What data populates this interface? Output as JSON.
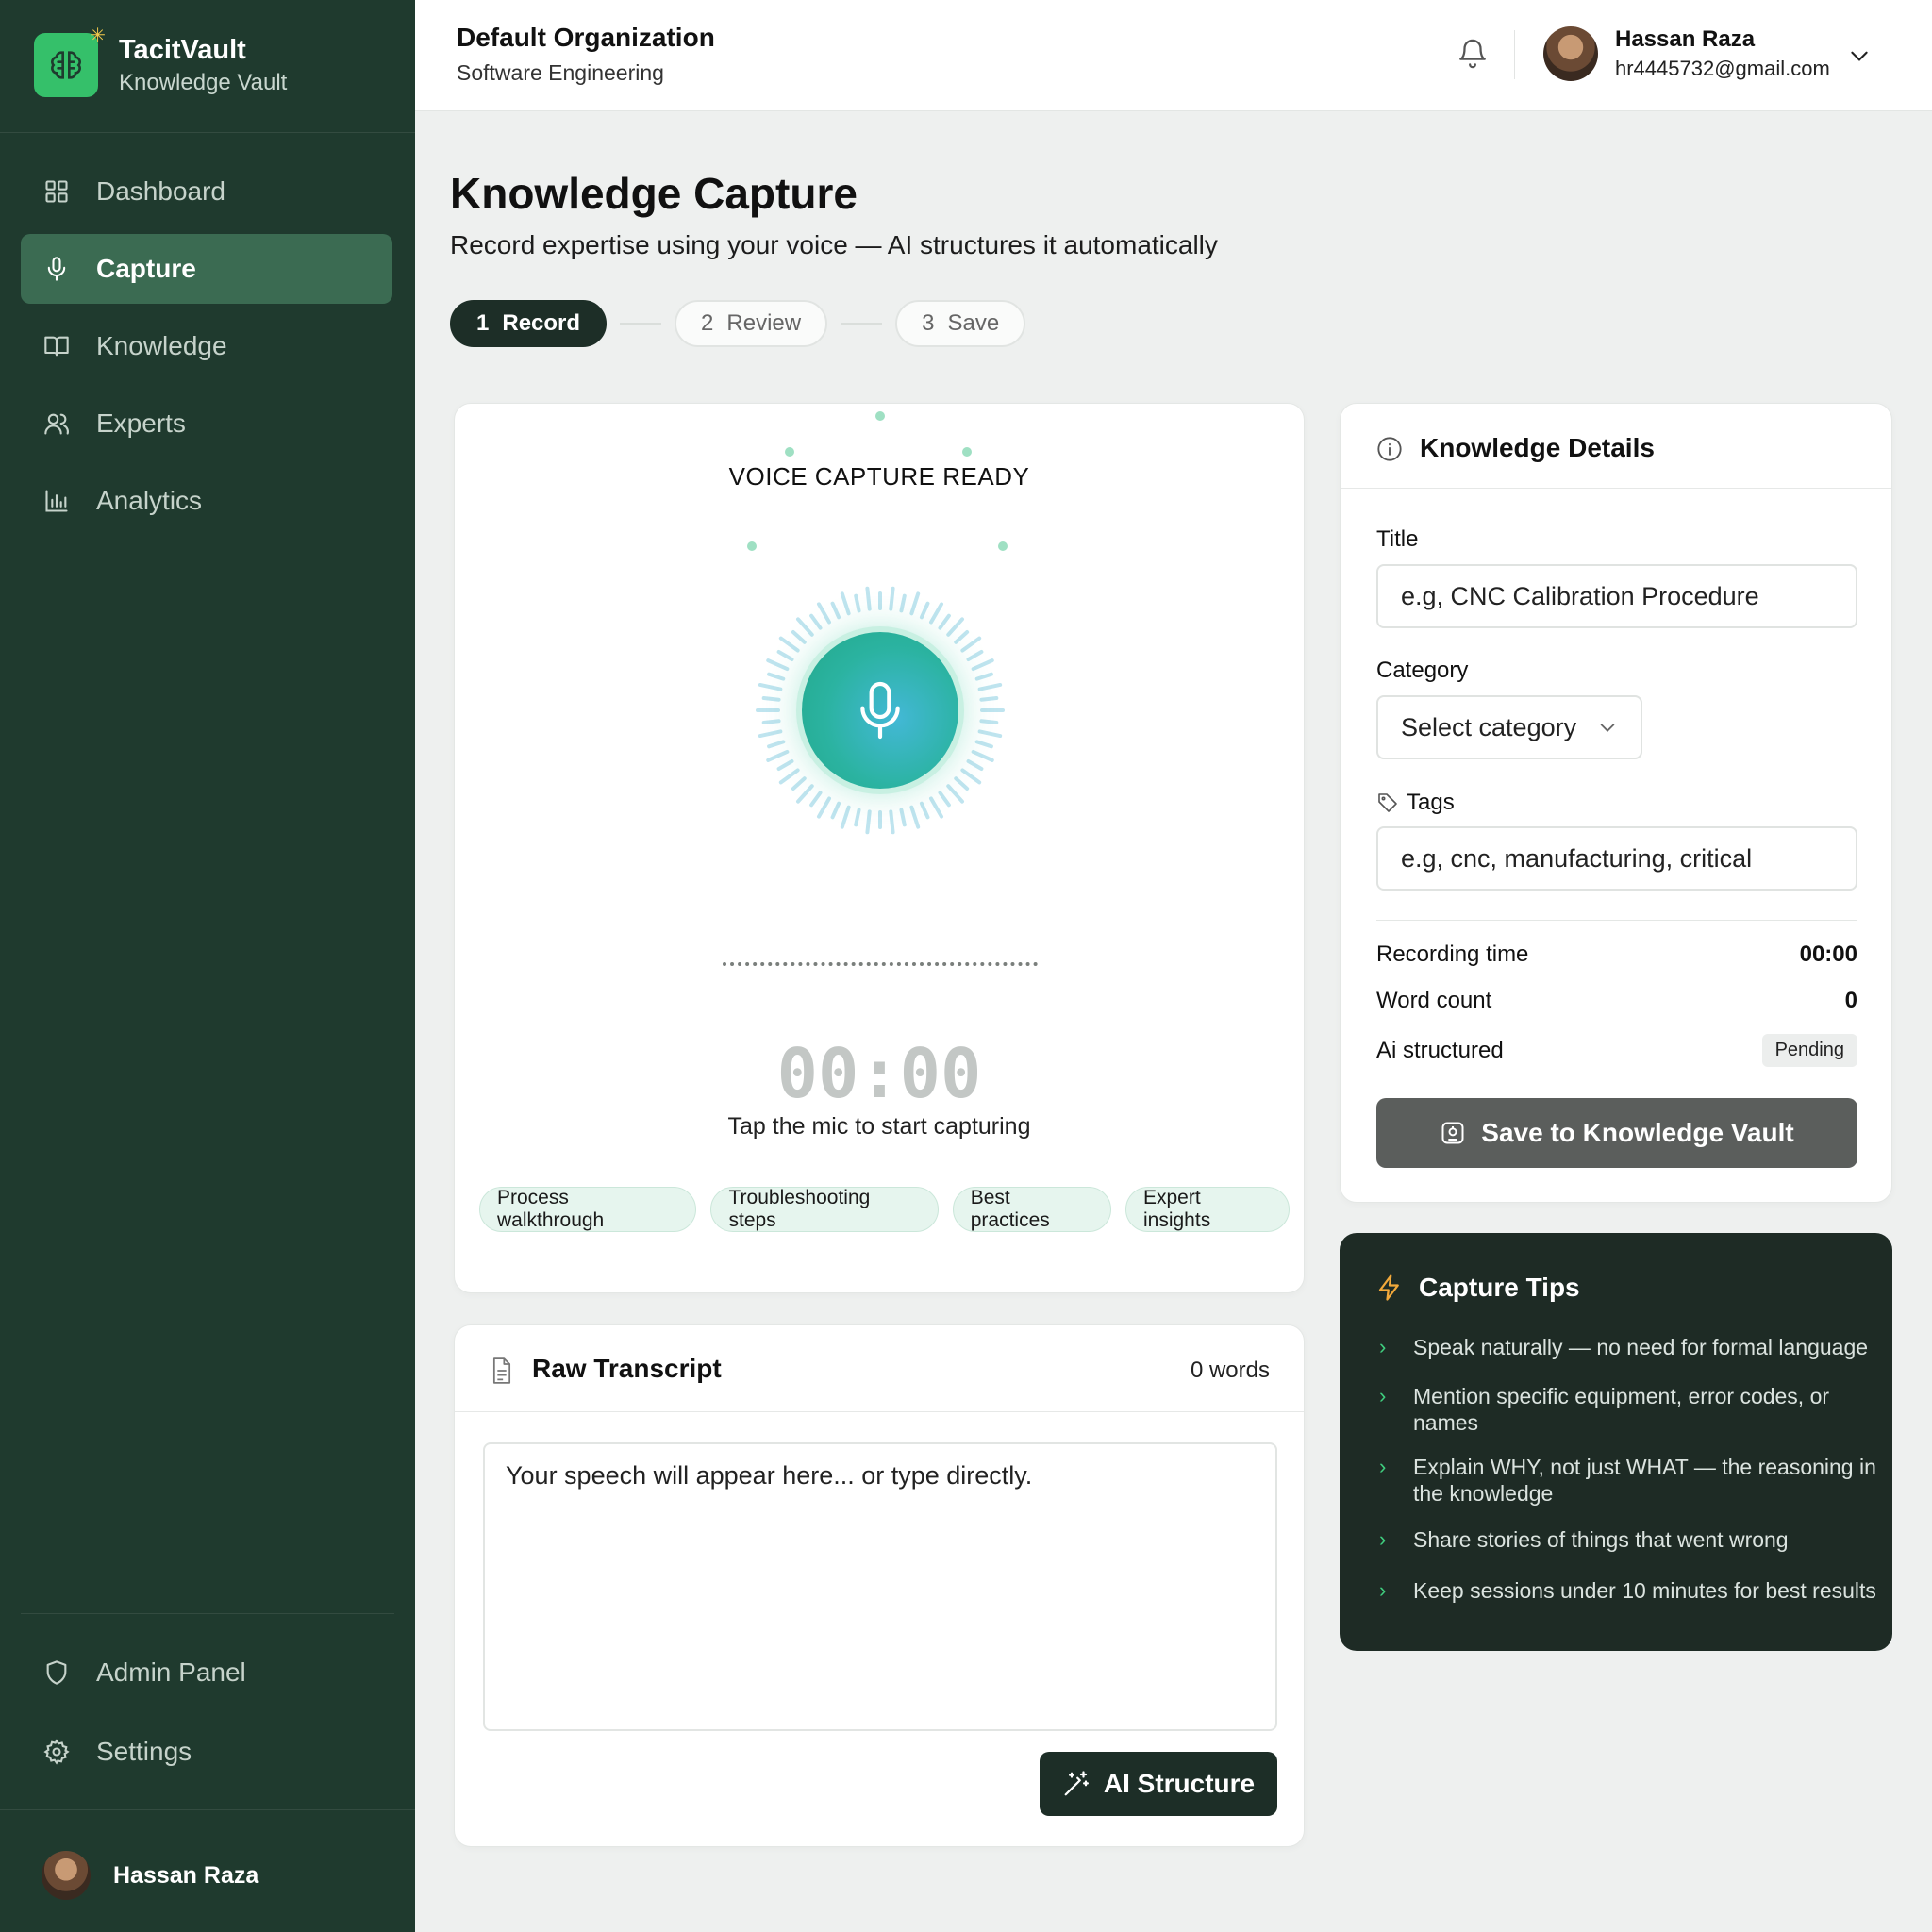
{
  "brand": {
    "name": "TacitVault",
    "subtitle": "Knowledge Vault",
    "accent": "#35c06a"
  },
  "sidebar": {
    "items": [
      {
        "label": "Dashboard",
        "icon": "grid-icon",
        "active": false
      },
      {
        "label": "Capture",
        "icon": "mic-icon",
        "active": true
      },
      {
        "label": "Knowledge",
        "icon": "book-icon",
        "active": false
      },
      {
        "label": "Experts",
        "icon": "users-icon",
        "active": false
      },
      {
        "label": "Analytics",
        "icon": "bar-chart-icon",
        "active": false
      }
    ],
    "bottom_items": [
      {
        "label": "Admin Panel",
        "icon": "shield-icon"
      },
      {
        "label": "Settings",
        "icon": "gear-icon"
      }
    ],
    "user": {
      "name": "Hassan Raza"
    }
  },
  "header": {
    "org_name": "Default Organization",
    "org_dept": "Software Engineering",
    "user_name": "Hassan Raza",
    "user_email": "hr4445732@gmail.com"
  },
  "page": {
    "title": "Knowledge Capture",
    "subtitle": "Record expertise using your voice — AI structures it automatically",
    "steps": [
      {
        "num": "1",
        "label": "Record",
        "active": true
      },
      {
        "num": "2",
        "label": "Review",
        "active": false
      },
      {
        "num": "3",
        "label": "Save",
        "active": false
      }
    ]
  },
  "capture": {
    "status": "VOICE CAPTURE READY",
    "timer": "00:00",
    "hint": "Tap the mic to start capturing",
    "chips": [
      "Process walkthrough",
      "Troubleshooting steps",
      "Best practices",
      "Expert insights"
    ]
  },
  "transcript": {
    "title": "Raw Transcript",
    "word_count": "0 words",
    "placeholder": "Your speech will appear here... or type directly.",
    "ai_button": "AI Structure"
  },
  "details": {
    "title": "Knowledge Details",
    "title_label": "Title",
    "title_placeholder": "e.g, CNC Calibration Procedure",
    "category_label": "Category",
    "category_value": "Select category",
    "tags_label": "Tags",
    "tags_placeholder": "e.g, cnc, manufacturing, critical",
    "recording_time_label": "Recording time",
    "recording_time_value": "00:00",
    "word_count_label": "Word count",
    "word_count_value": "0",
    "ai_structured_label": "Ai structured",
    "ai_structured_value": "Pending",
    "save_button": "Save to Knowledge Vault"
  },
  "tips": {
    "title": "Capture Tips",
    "items": [
      "Speak naturally — no need for formal language",
      "Mention specific equipment, error codes, or names",
      "Explain WHY, not just WHAT — the reasoning in the knowledge",
      "Share stories of things that went wrong",
      "Keep sessions under 10 minutes for best results"
    ]
  }
}
